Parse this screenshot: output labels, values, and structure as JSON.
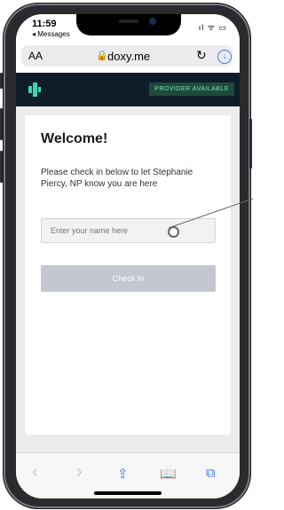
{
  "status_bar": {
    "time": "11:59",
    "back_app": "◂ Messages",
    "icons": "ıl ᯤ ▭"
  },
  "browser": {
    "text_size": "AA",
    "lock": "🔒",
    "domain": "doxy.me",
    "reload": "↻",
    "download": "↓"
  },
  "header": {
    "badge": "PROVIDER AVAILABLE",
    "accent": "#3dd6b5"
  },
  "card": {
    "title": "Welcome!",
    "instructions": "Please check in below to let Stephanie Piercy, NP know you are here",
    "name_placeholder": "Enter your name here",
    "checkin_label": "Check In"
  },
  "toolbar": {
    "back": "‹",
    "forward": "›",
    "share": "⇪",
    "bookmarks": "📖",
    "tabs": "⧉"
  }
}
